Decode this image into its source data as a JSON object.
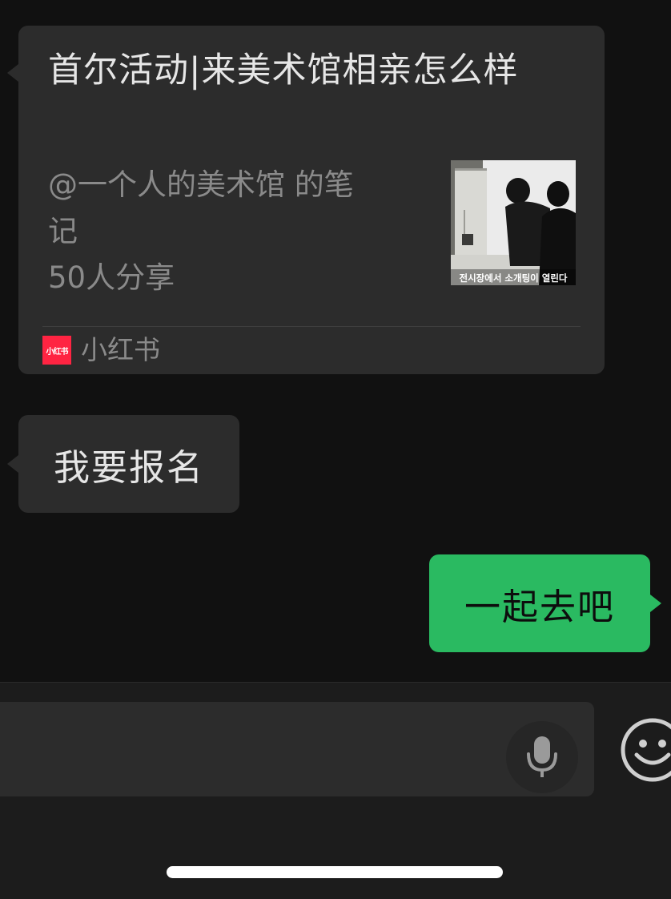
{
  "chat": {
    "shared_card": {
      "title": "首尔活动|来美术馆相亲怎么样",
      "author_line1": "@一个人的美术馆 的笔",
      "author_line2": "记",
      "share_count": "50人分享",
      "thumbnail_caption": "전시장에서 소개팅이 열린다",
      "source_logo_text": "小红书",
      "source_name": "小红书",
      "source_brand_color": "#ff2442"
    },
    "messages": [
      {
        "direction": "incoming",
        "text": "我要报名"
      },
      {
        "direction": "outgoing",
        "text": "一起去吧"
      }
    ]
  },
  "input_bar": {
    "text_value": "",
    "mic_icon": "microphone-icon",
    "emoji_icon": "smiley-face-icon"
  },
  "colors": {
    "chat_background": "#111111",
    "incoming_bubble": "#2c2c2c",
    "outgoing_bubble": "#2aba61",
    "input_bar_background": "#1c1c1c"
  }
}
